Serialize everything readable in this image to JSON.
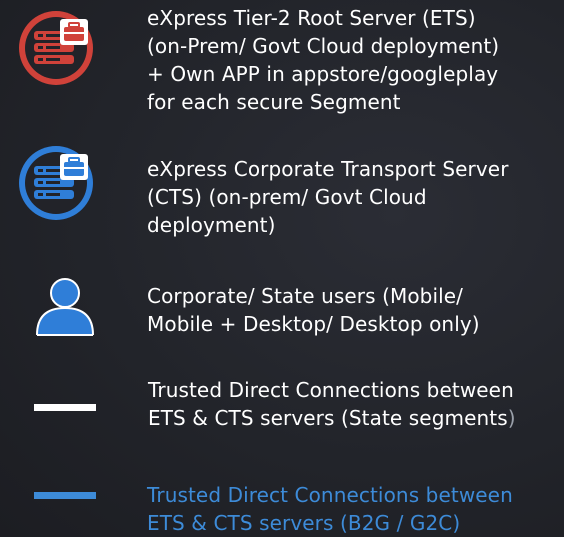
{
  "legend": {
    "items": [
      {
        "key": "ets",
        "icon": "server-briefcase-red-icon",
        "color": "#d0423a",
        "lines": [
          "eXpress Tier-2 Root Server (ETS)",
          "(on-Prem/ Govt Cloud deployment)",
          "+ Own APP in appstore/googleplay",
          "for each secure Segment"
        ]
      },
      {
        "key": "cts",
        "icon": "server-briefcase-blue-icon",
        "color": "#2f7ed8",
        "lines": [
          "eXpress Corporate Transport Server",
          "(CTS) (on-prem/ Govt Cloud",
          "deployment)"
        ]
      },
      {
        "key": "users",
        "icon": "user-icon",
        "color": "#2f7ed8",
        "lines": [
          "Corporate/ State users (Mobile/",
          "Mobile + Desktop/ Desktop only)"
        ]
      },
      {
        "key": "state-connection",
        "icon": "white-line-swatch",
        "color": "#ffffff",
        "lines": [
          "Trusted Direct Connections between",
          "ETS & CTS servers (State segments",
          ")"
        ]
      },
      {
        "key": "b2g-connection",
        "icon": "blue-line-swatch",
        "color": "#3d8bd8",
        "lines": [
          "Trusted Direct Connections between",
          "ETS & CTS servers (B2G / G2C)"
        ]
      }
    ]
  }
}
